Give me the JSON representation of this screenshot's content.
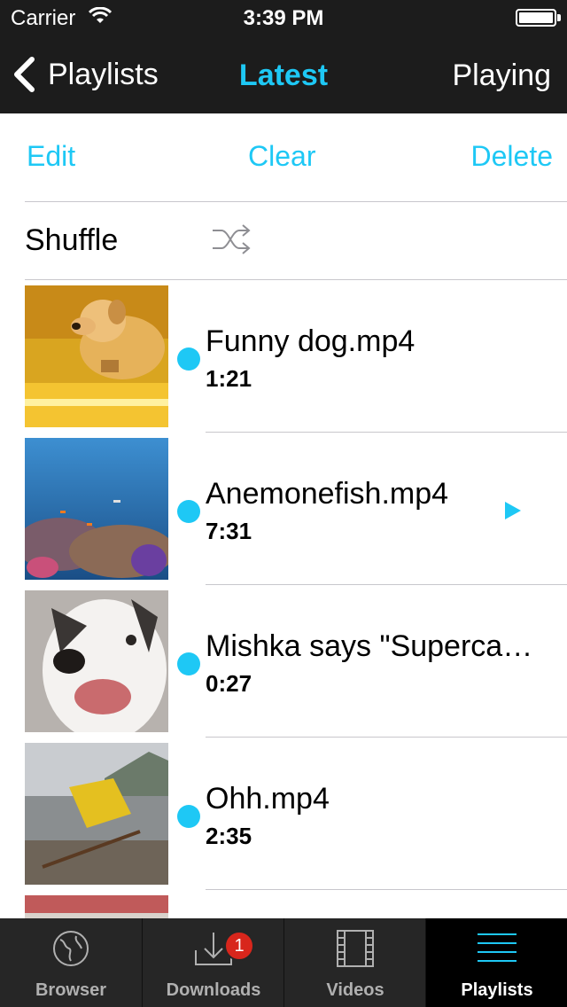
{
  "status_bar": {
    "carrier": "Carrier",
    "time": "3:39 PM"
  },
  "nav": {
    "back_label": "Playlists",
    "title": "Latest",
    "right_label": "Playing"
  },
  "toolbar": {
    "edit_label": "Edit",
    "clear_label": "Clear",
    "delete_label": "Delete"
  },
  "shuffle": {
    "label": "Shuffle",
    "icon": "shuffle-icon"
  },
  "items": [
    {
      "title": "Funny dog.mp4",
      "duration": "1:21",
      "playing": false
    },
    {
      "title": "Anemonefish.mp4",
      "duration": "7:31",
      "playing": true
    },
    {
      "title": "Mishka says \"Superca…",
      "duration": "0:27",
      "playing": false
    },
    {
      "title": "Ohh.mp4",
      "duration": "2:35",
      "playing": false
    }
  ],
  "tabs": [
    {
      "label": "Browser",
      "icon": "globe-icon"
    },
    {
      "label": "Downloads",
      "icon": "download-icon",
      "badge": "1"
    },
    {
      "label": "Videos",
      "icon": "film-icon"
    },
    {
      "label": "Playlists",
      "icon": "list-icon",
      "active": true
    }
  ],
  "colors": {
    "accent": "#1ec8f5",
    "bar": "#1c1c1c",
    "badge": "#d8261c"
  }
}
